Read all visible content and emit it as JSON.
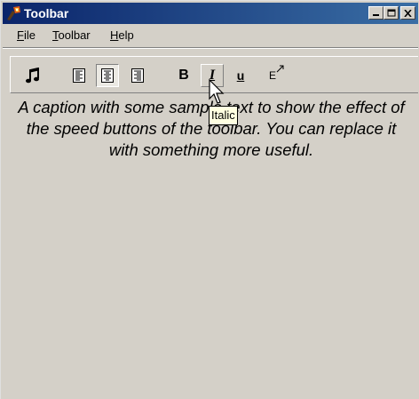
{
  "window": {
    "title": "Toolbar",
    "icon": "torch-app-icon"
  },
  "title_buttons": [
    {
      "name": "minimize-button",
      "icon": "minimize-icon"
    },
    {
      "name": "maximize-button",
      "icon": "maximize-icon"
    },
    {
      "name": "close-button",
      "icon": "close-icon"
    }
  ],
  "menu": {
    "file": {
      "first": "F",
      "rest": "ile"
    },
    "toolbar": {
      "first": "T",
      "rest": "oolbar"
    },
    "help": {
      "first": "H",
      "rest": "elp"
    }
  },
  "toolbar": {
    "buttons": [
      {
        "name": "music-icon"
      },
      {
        "name": "align-left-icon"
      },
      {
        "name": "align-center-icon",
        "state": "pressed"
      },
      {
        "name": "align-right-icon"
      },
      {
        "name": "bold-icon",
        "label": "B"
      },
      {
        "name": "italic-icon",
        "label": "I",
        "state": "hover"
      },
      {
        "name": "underline-icon",
        "label": "u"
      },
      {
        "name": "font-size-icon",
        "label": "E"
      }
    ]
  },
  "caption": "A caption with some sample text to show the effect of the speed buttons of the toolbar. You can replace it with something more useful.",
  "tooltip": "Italic",
  "colors": {
    "titlebar_start": "#0a246a",
    "titlebar_end": "#3a6ea5",
    "face": "#d4d0c8",
    "tooltip_bg": "#ffffe1"
  }
}
